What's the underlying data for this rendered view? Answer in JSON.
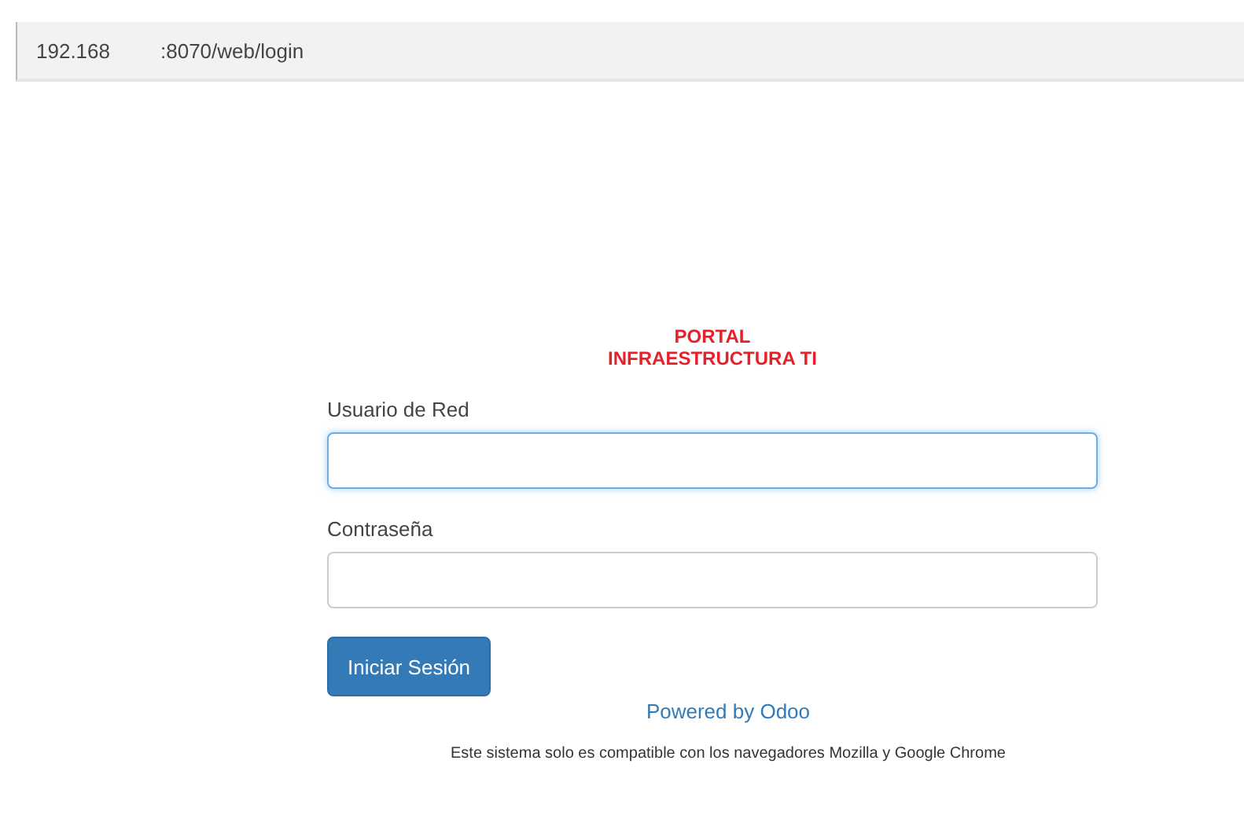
{
  "address_bar": {
    "host": "192.168",
    "path": ":8070/web/login"
  },
  "title": {
    "line1": "PORTAL",
    "line2": "INFRAESTRUCTURA TI"
  },
  "fields": [
    {
      "label": "Usuario de Red",
      "focused": true
    },
    {
      "label": "Contraseña",
      "focused": false
    }
  ],
  "login_button": "Iniciar Sesión",
  "powered_by": "Powered by Odoo",
  "footer_note": "Este sistema solo es compatible con los navegadores Mozilla y Google Chrome"
}
